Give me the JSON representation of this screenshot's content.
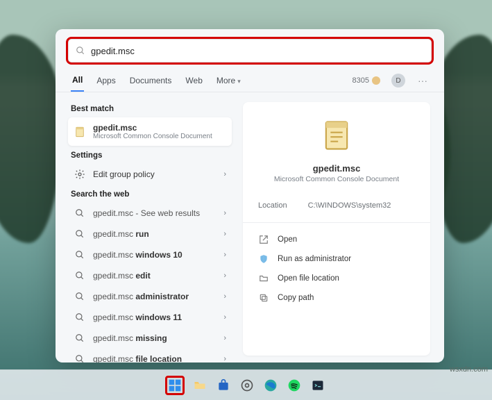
{
  "search": {
    "value": "gpedit.msc"
  },
  "tabs": {
    "all": "All",
    "apps": "Apps",
    "documents": "Documents",
    "web": "Web",
    "more": "More"
  },
  "header": {
    "points": "8305",
    "avatar_initial": "D",
    "more": "···"
  },
  "sections": {
    "best_match": "Best match",
    "settings": "Settings",
    "search_web": "Search the web"
  },
  "best": {
    "title": "gpedit.msc",
    "subtitle": "Microsoft Common Console Document"
  },
  "settings_items": [
    {
      "label": "Edit group policy"
    }
  ],
  "web_items": [
    {
      "pre": "gpedit.msc",
      "post": " - See web results"
    },
    {
      "pre": "gpedit.msc ",
      "post": "run"
    },
    {
      "pre": "gpedit.msc ",
      "post": "windows 10"
    },
    {
      "pre": "gpedit.msc ",
      "post": "edit"
    },
    {
      "pre": "gpedit.msc ",
      "post": "administrator"
    },
    {
      "pre": "gpedit.msc ",
      "post": "windows 11"
    },
    {
      "pre": "gpedit.msc ",
      "post": "missing"
    },
    {
      "pre": "gpedit.msc ",
      "post": "file location"
    }
  ],
  "detail": {
    "title": "gpedit.msc",
    "subtitle": "Microsoft Common Console Document",
    "location_label": "Location",
    "location_value": "C:\\WINDOWS\\system32",
    "actions": {
      "open": "Open",
      "admin": "Run as administrator",
      "loc": "Open file location",
      "copy": "Copy path"
    }
  },
  "watermark": "wsxdn.com"
}
